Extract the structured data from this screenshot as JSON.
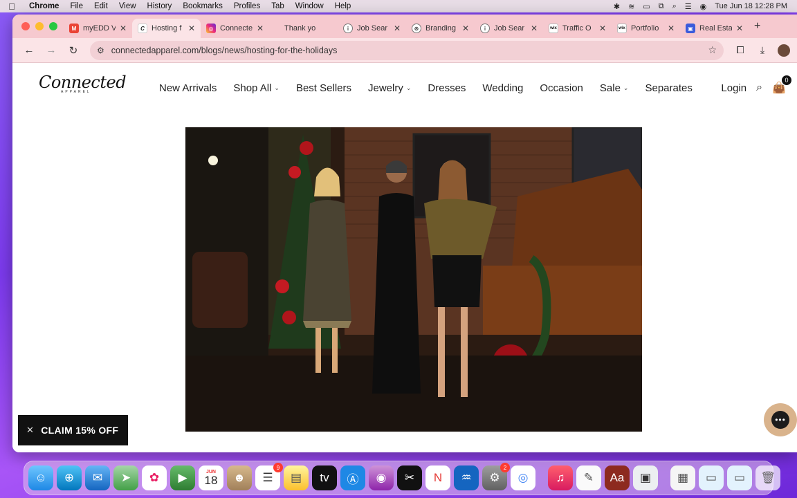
{
  "menubar": {
    "app": "Chrome",
    "items": [
      "File",
      "Edit",
      "View",
      "History",
      "Bookmarks",
      "Profiles",
      "Tab",
      "Window",
      "Help"
    ],
    "datetime": "Tue Jun 18  12:28 PM"
  },
  "tabs": [
    {
      "label": "myEDD V",
      "icon_color": "#ea4335",
      "icon_text": "M"
    },
    {
      "label": "Hosting f",
      "icon_color": "#ffffff",
      "icon_text": "C",
      "active": true
    },
    {
      "label": "Connecte",
      "icon_color": "#d62976",
      "icon_text": "◎"
    },
    {
      "label": "Thank yo",
      "icon_color": "#f6c9cf",
      "icon_text": ""
    },
    {
      "label": "Job Sear",
      "icon_color": "#555555",
      "icon_text": "i"
    },
    {
      "label": "Branding",
      "icon_color": "#555555",
      "icon_text": "⊛"
    },
    {
      "label": "Job Sear",
      "icon_color": "#555555",
      "icon_text": "i"
    },
    {
      "label": "Traffic O",
      "icon_color": "#ffffff",
      "icon_text": "wix"
    },
    {
      "label": "Portfolio",
      "icon_color": "#ffffff",
      "icon_text": "wix"
    },
    {
      "label": "Real Esta",
      "icon_color": "#3b5bdb",
      "icon_text": "▣"
    }
  ],
  "toolbar": {
    "url": "connectedapparel.com/blogs/news/hosting-for-the-holidays"
  },
  "site": {
    "logo_text": "Connected",
    "logo_sub": "APPAREL",
    "nav": [
      {
        "label": "New Arrivals",
        "dropdown": false
      },
      {
        "label": "Shop All",
        "dropdown": true
      },
      {
        "label": "Best Sellers",
        "dropdown": false
      },
      {
        "label": "Jewelry",
        "dropdown": true
      },
      {
        "label": "Dresses",
        "dropdown": false
      },
      {
        "label": "Wedding",
        "dropdown": false
      },
      {
        "label": "Occasion",
        "dropdown": false
      },
      {
        "label": "Sale",
        "dropdown": true
      },
      {
        "label": "Separates",
        "dropdown": false
      }
    ],
    "login_label": "Login",
    "cart_count": "0",
    "claim_label": "CLAIM 15% OFF"
  },
  "dock": {
    "calendar_month": "JUN",
    "calendar_day": "18",
    "reminders_badge": "9",
    "settings_badge": "2"
  }
}
